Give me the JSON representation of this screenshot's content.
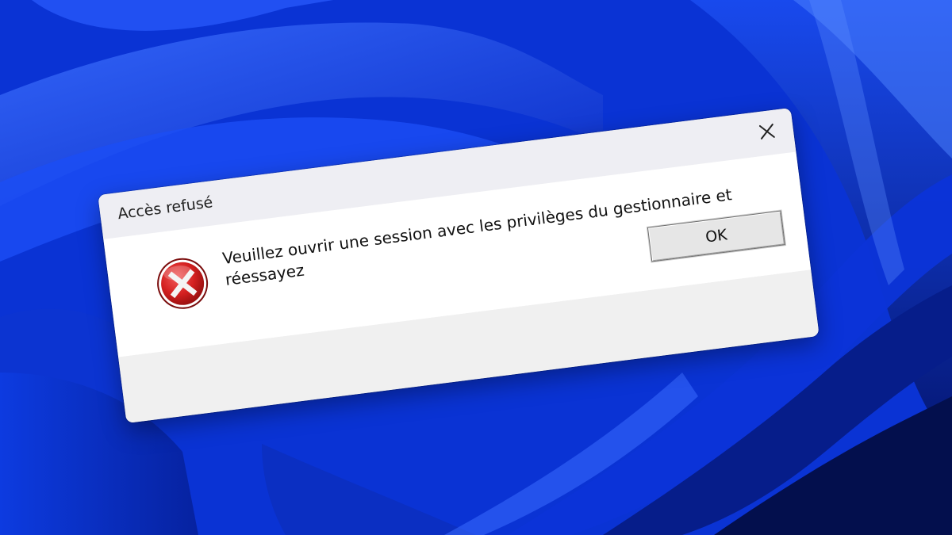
{
  "desktop": {
    "wallpaper": "windows-11-bloom",
    "colors": {
      "primary": "#0b3fe6",
      "dark": "#061a7a",
      "highlight": "#4f86ff"
    }
  },
  "dialog": {
    "title": "Accès refusé",
    "message": "Veuillez ouvrir une session avec les privilèges du gestionnaire et réessayez",
    "icon": "error-icon",
    "close_icon": "close-icon",
    "ok_label": "OK",
    "colors": {
      "error_red": "#d42020",
      "titlebar": "#eeeef3",
      "content": "#ffffff",
      "footer": "#f0f0f0"
    }
  }
}
